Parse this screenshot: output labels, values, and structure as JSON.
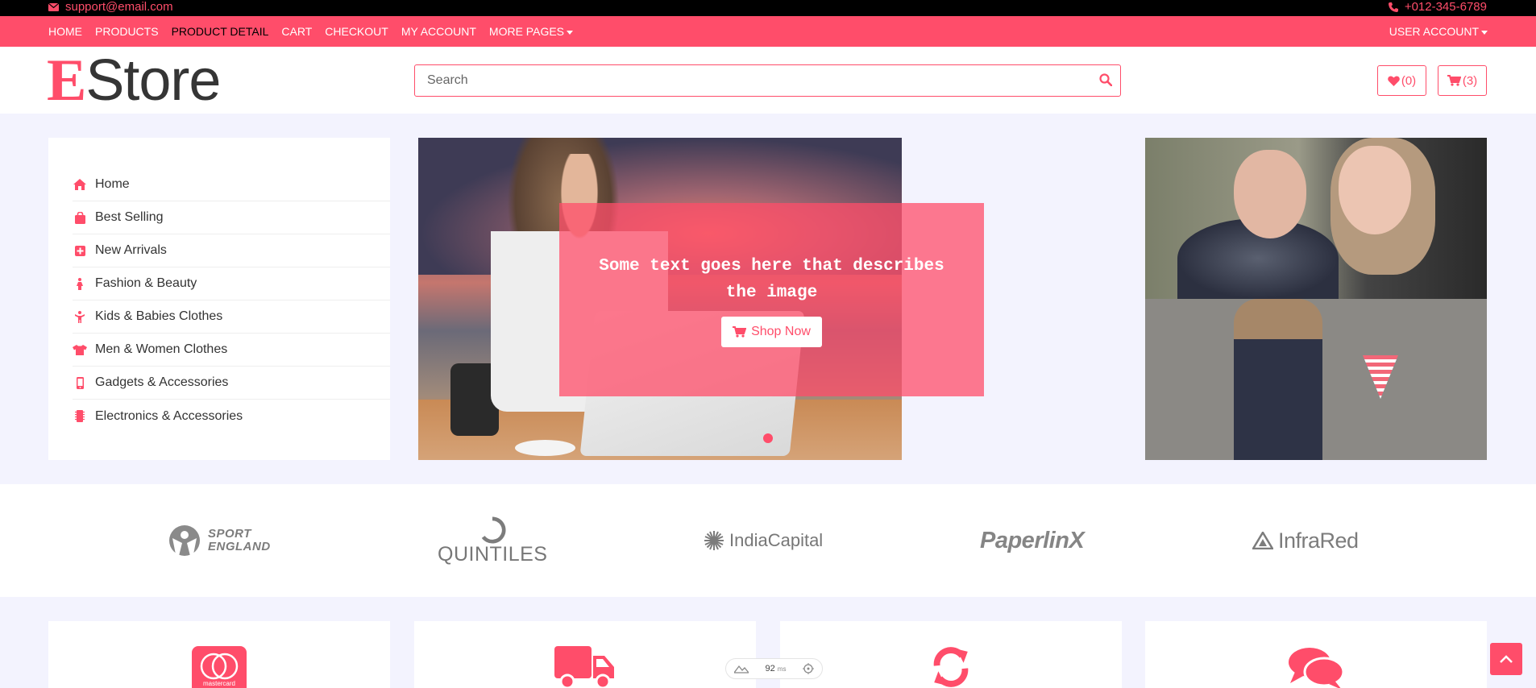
{
  "topbar": {
    "email": "support@email.com",
    "phone": "+012-345-6789"
  },
  "nav": {
    "items": [
      {
        "label": "HOME",
        "active": false
      },
      {
        "label": "PRODUCTS",
        "active": false
      },
      {
        "label": "PRODUCT DETAIL",
        "active": true
      },
      {
        "label": "CART",
        "active": false
      },
      {
        "label": "CHECKOUT",
        "active": false
      },
      {
        "label": "MY ACCOUNT",
        "active": false
      },
      {
        "label": "MORE PAGES",
        "active": false
      }
    ],
    "user_account": "USER ACCOUNT"
  },
  "header": {
    "logo_first": "E",
    "logo_rest": "Store",
    "search_placeholder": "Search",
    "wishlist_count": "(0)",
    "cart_count": "(3)"
  },
  "sidebar": {
    "items": [
      {
        "label": "Home",
        "icon": "home-icon"
      },
      {
        "label": "Best Selling",
        "icon": "shopping-bag-icon"
      },
      {
        "label": "New Arrivals",
        "icon": "plus-square-icon"
      },
      {
        "label": "Fashion & Beauty",
        "icon": "female-icon"
      },
      {
        "label": "Kids & Babies Clothes",
        "icon": "child-icon"
      },
      {
        "label": "Men & Women Clothes",
        "icon": "tshirt-icon"
      },
      {
        "label": "Gadgets & Accessories",
        "icon": "mobile-icon"
      },
      {
        "label": "Electronics & Accessories",
        "icon": "microchip-icon"
      }
    ]
  },
  "slider": {
    "caption": "Some text goes here that describes the image",
    "button": "Shop Now"
  },
  "brands": {
    "sport_line1": "SPORT",
    "sport_line2": "ENGLAND",
    "quintiles": "QUINTILES",
    "india_capital": "IndiaCapital",
    "paperlinx": "PaperlinX",
    "infrared": "InfraRed"
  },
  "features": {
    "card1_badge": "mastercard",
    "icons": [
      "mastercard-icon",
      "truck-icon",
      "sync-icon",
      "comments-icon"
    ]
  },
  "perf_badge": {
    "value": "92",
    "unit": "ms"
  },
  "colors": {
    "accent": "#ff4d6a",
    "page_bg": "#f3f3fe"
  }
}
